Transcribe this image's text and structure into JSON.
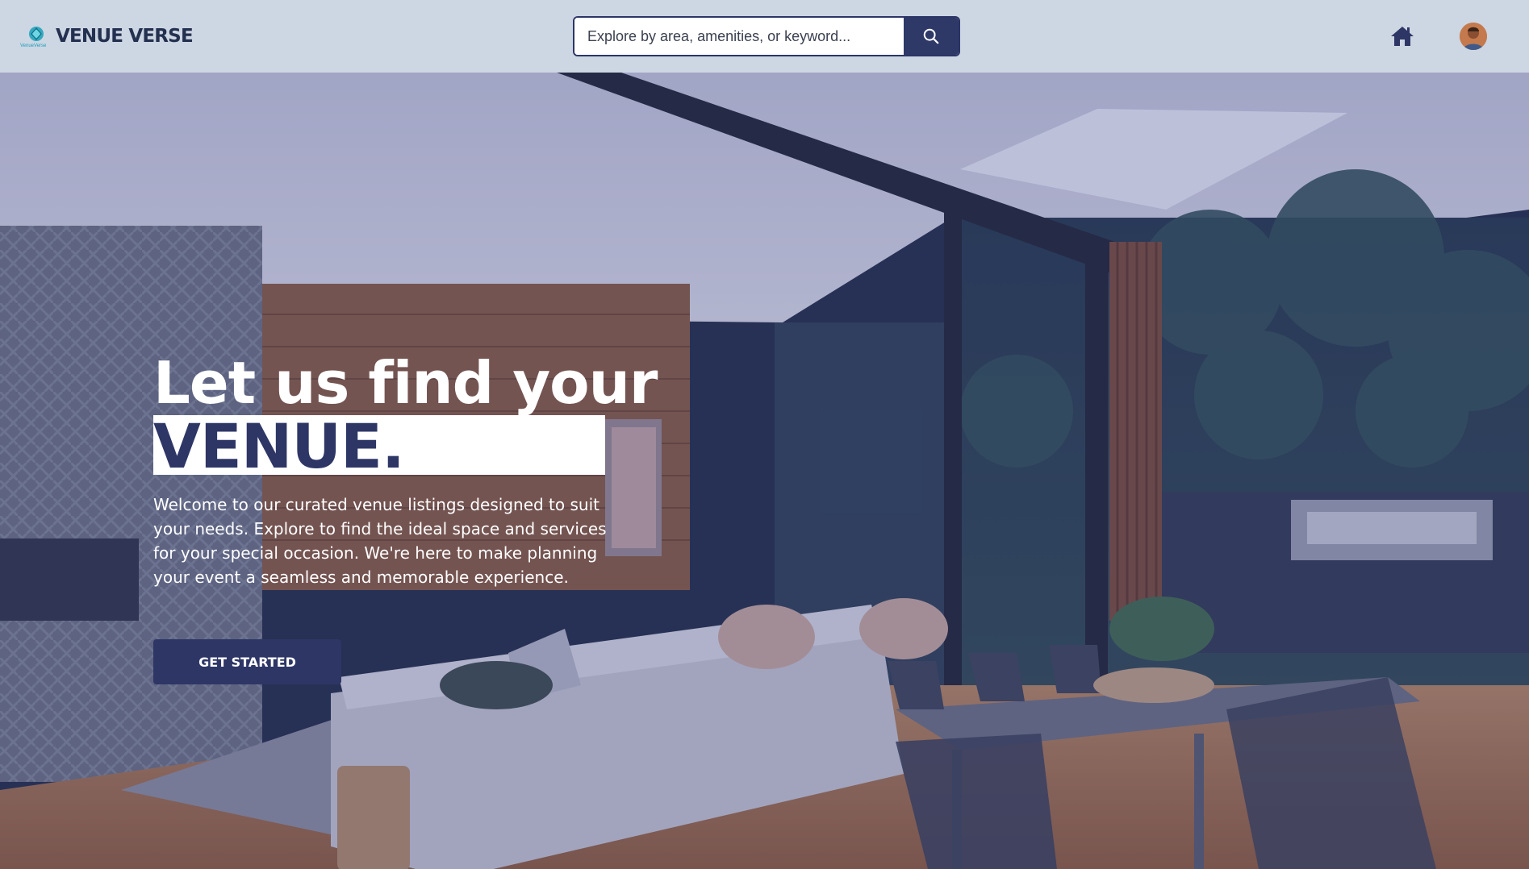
{
  "brand": {
    "name": "VENUE VERSE",
    "mark_text": "VenueVerse",
    "accent": "#1aa0b8",
    "dark": "#23304f"
  },
  "search": {
    "placeholder": "Explore by area, amenities, or keyword...",
    "value": "",
    "button_icon": "search-icon"
  },
  "nav": {
    "home_icon": "home-icon",
    "avatar": "user-avatar"
  },
  "hero": {
    "headline_line1": "Let us find your",
    "headline_line2": "VENUE.",
    "intro": "Welcome to our curated venue listings designed to suit your needs. Explore to find the ideal space and services for your special occasion. We're here to make planning your event a seamless and memorable experience.",
    "cta_label": "GET STARTED"
  },
  "colors": {
    "navbar_bg": "#cdd6e3",
    "primary": "#2e3666",
    "search_button": "#2e3968"
  }
}
